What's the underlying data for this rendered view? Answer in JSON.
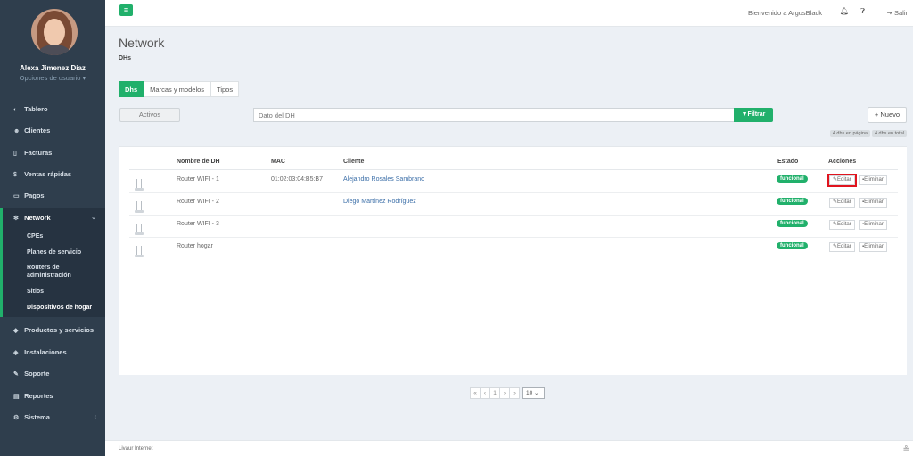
{
  "user": {
    "name": "Alexa Jimenez Díaz",
    "options": "Opciones de usuario ▾"
  },
  "nav": {
    "tablero": "Tablero",
    "clientes": "Clientes",
    "facturas": "Facturas",
    "ventas": "Ventas rápidas",
    "pagos": "Pagos",
    "network": "Network",
    "productos": "Productos y servicios",
    "instalaciones": "Instalaciones",
    "soporte": "Soporte",
    "reportes": "Reportes",
    "sistema": "Sistema"
  },
  "submenu": {
    "cpes": "CPEs",
    "planes": "Planes de servicio",
    "routers_1": "Routers de",
    "routers_2": "administración",
    "sitios": "Sitios",
    "dispositivos": "Dispositivos de hogar"
  },
  "topbar": {
    "welcome": "Bienvenido a ArgusBlack",
    "logout": "Salir"
  },
  "page": {
    "title": "Network",
    "subtitle": "DHs"
  },
  "tabs": [
    "Dhs",
    "Marcas y modelos",
    "Tipos"
  ],
  "filters": {
    "status": "Activos",
    "search_placeholder": "Dato del DH",
    "filter_label": "Filtrar",
    "new_label": "Nuevo",
    "count_page": "4 dhs en página",
    "count_total": "4 dhs en total"
  },
  "table": {
    "headers": {
      "name": "Nombre de DH",
      "mac": "MAC",
      "client": "Cliente",
      "status": "Estado",
      "actions": "Acciones"
    },
    "rows": [
      {
        "name": "Router WIFI - 1",
        "mac": "01:02:03:04:B5:B7",
        "client": "Alejandro Rosales Sambrano",
        "status": "funcional"
      },
      {
        "name": "Router WIFI - 2",
        "mac": "",
        "client": "Diego Martínez Rodríguez",
        "status": "funcional"
      },
      {
        "name": "Router WIFI - 3",
        "mac": "",
        "client": "",
        "status": "funcional"
      },
      {
        "name": "Router hogar",
        "mac": "",
        "client": "",
        "status": "funcional"
      }
    ],
    "edit_label": "Editar",
    "delete_label": "Eliminar"
  },
  "pagination": {
    "first": "«",
    "prev": "‹",
    "page": "1",
    "next": "›",
    "last": "»",
    "per_page": "10"
  },
  "footer": {
    "text": "Livaur Internet"
  },
  "colors": {
    "accent": "#21b06b",
    "sidebar": "#2f3e4d",
    "highlight": "#e0141e"
  }
}
